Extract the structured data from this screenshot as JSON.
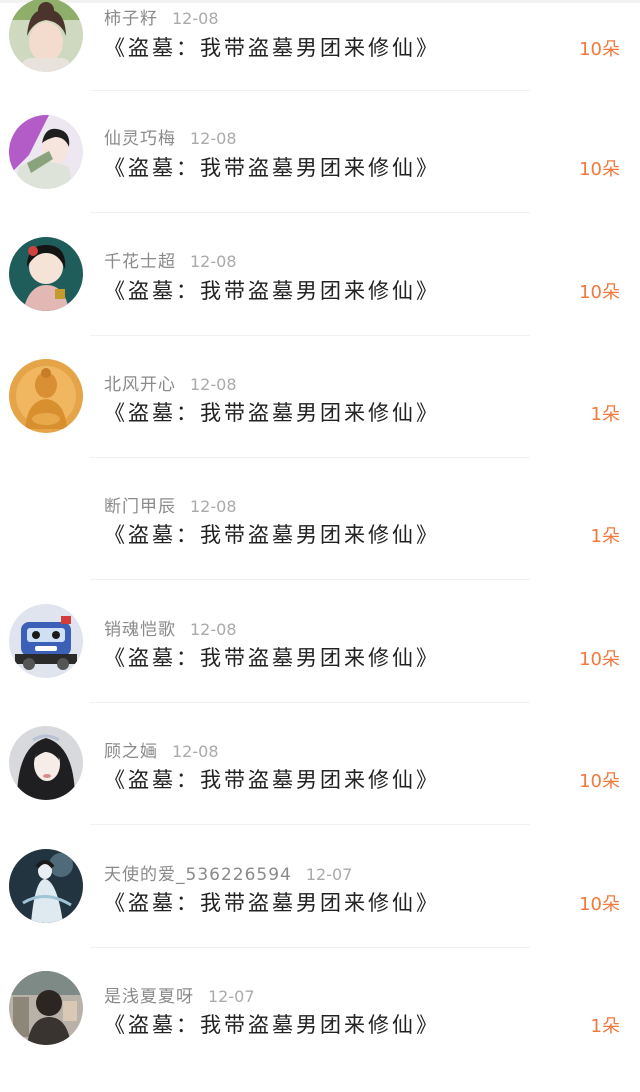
{
  "gifts": [
    {
      "user": "柿子籽",
      "date": "12-08",
      "book": "《盗墓：我带盗墓男团来修仙》",
      "amount": "10朵",
      "avatar": "girl-portrait-avatar"
    },
    {
      "user": "仙灵巧梅",
      "date": "12-08",
      "book": "《盗墓：我带盗墓男团来修仙》",
      "amount": "10朵",
      "avatar": "anime-couple-avatar"
    },
    {
      "user": "千花士超",
      "date": "12-08",
      "book": "《盗墓：我带盗墓男团来修仙》",
      "amount": "10朵",
      "avatar": "illustrated-woman-avatar"
    },
    {
      "user": "北风开心",
      "date": "12-08",
      "book": "《盗墓：我带盗墓男团来修仙》",
      "amount": "1朵",
      "avatar": "buddha-statue-avatar"
    },
    {
      "user": "断门甲辰",
      "date": "12-08",
      "book": "《盗墓：我带盗墓男团来修仙》",
      "amount": "1朵",
      "avatar": "blank-avatar"
    },
    {
      "user": "销魂恺歌",
      "date": "12-08",
      "book": "《盗墓：我带盗墓男团来修仙》",
      "amount": "10朵",
      "avatar": "cartoon-car-avatar"
    },
    {
      "user": "顾之婳",
      "date": "12-08",
      "book": "《盗墓：我带盗墓男团来修仙》",
      "amount": "10朵",
      "avatar": "costume-woman-avatar"
    },
    {
      "user": "天使的爱_536226594",
      "date": "12-07",
      "book": "《盗墓：我带盗墓男团来修仙》",
      "amount": "10朵",
      "avatar": "fairy-figure-avatar"
    },
    {
      "user": "是浅夏夏呀",
      "date": "12-07",
      "book": "《盗墓：我带盗墓男团来修仙》",
      "amount": "1朵",
      "avatar": "photo-person-avatar"
    }
  ],
  "colors": {
    "amount": "#f2783c",
    "title": "#222222",
    "meta": "#8a8a8a"
  }
}
